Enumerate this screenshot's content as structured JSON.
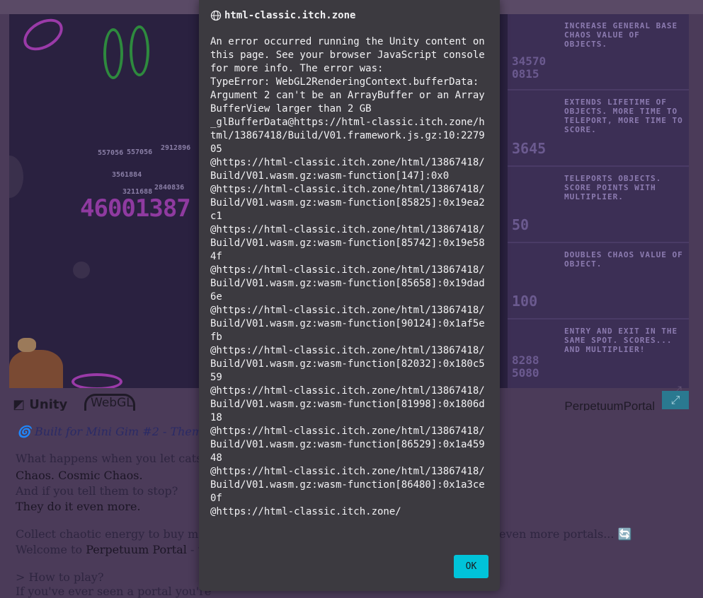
{
  "dialog": {
    "host": "html-classic.itch.zone",
    "message": "An error occurred running the Unity content on this page. See your browser JavaScript console for more info. The error was:\nTypeError: WebGL2RenderingContext.bufferData: Argument 2 can't be an ArrayBuffer or an ArrayBufferView larger than 2 GB\n_glBufferData@https://html-classic.itch.zone/html/13867418/Build/V01.framework.js.gz:10:227905\n@https://html-classic.itch.zone/html/13867418/Build/V01.wasm.gz:wasm-function[147]:0x0\n@https://html-classic.itch.zone/html/13867418/Build/V01.wasm.gz:wasm-function[85825]:0x19ea2c1\n@https://html-classic.itch.zone/html/13867418/Build/V01.wasm.gz:wasm-function[85742]:0x19e584f\n@https://html-classic.itch.zone/html/13867418/Build/V01.wasm.gz:wasm-function[85658]:0x19dad6e\n@https://html-classic.itch.zone/html/13867418/Build/V01.wasm.gz:wasm-function[90124]:0x1af5efb\n@https://html-classic.itch.zone/html/13867418/Build/V01.wasm.gz:wasm-function[82032]:0x180c559\n@https://html-classic.itch.zone/html/13867418/Build/V01.wasm.gz:wasm-function[81998]:0x1806d18\n@https://html-classic.itch.zone/html/13867418/Build/V01.wasm.gz:wasm-function[86529]:0x1a45948\n@https://html-classic.itch.zone/html/13867418/Build/V01.wasm.gz:wasm-function[86480]:0x1a3ce0f\n@https://html-classic.itch.zone/",
    "ok_label": "OK"
  },
  "game": {
    "big_score": "46001387",
    "score_pops": [
      "557056",
      "557056",
      "2912896",
      "3561884",
      "3211688",
      "2840836"
    ],
    "upgrades": [
      {
        "desc": "INCREASE GENERAL BASE CHAOS VALUE OF OBJECTS.",
        "cost": "34570 0815"
      },
      {
        "desc": "EXTENDS LIFETIME OF OBJECTS. MORE TIME TO TELEPORT, MORE TIME TO SCORE.",
        "cost": "3645"
      },
      {
        "desc": "TELEPORTS OBJECTS. SCORE POINTS WITH MULTIPLIER.",
        "cost": "50"
      },
      {
        "desc": "DOUBLES CHAOS VALUE OF OBJECT.",
        "cost": "100"
      },
      {
        "desc": "ENTRY AND EXIT IN THE SAME SPOT. SCORES... AND MULTIPLIER!",
        "cost": "8288 5080"
      }
    ]
  },
  "unity_bar": {
    "unity_label": "Unity",
    "webgl_label": "WebGL",
    "product_name": "PerpetuumPortal",
    "fullscreen_icon": "fullscreen-icon"
  },
  "description": {
    "built_for": "Built for Mini Gim #2 - Theme: ",
    "line1": "What happens when you let cats p",
    "line2": "Chaos. Cosmic Chaos.",
    "line3": "And if you tell them to stop?",
    "line4": "They do it even more.",
    "line5a": "Collect chaotic energy to buy more p",
    "line5b": "even more portals... 🔄",
    "line6a": "Welcome to ",
    "line6b": "Perpetuum Portal",
    "line6c": " - th",
    "line7": "> How to play?",
    "line8": "If you've ever seen a portal you're"
  }
}
